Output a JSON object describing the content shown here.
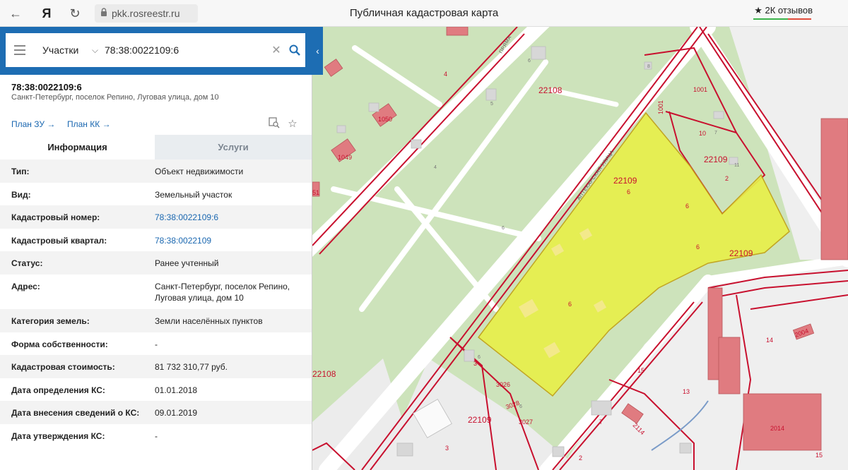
{
  "browser": {
    "url": "pkk.rosreestr.ru",
    "title": "Публичная кадастровая карта",
    "reviews": "2К отзывов",
    "brand_glyph": "Я"
  },
  "search": {
    "layer": "Участки",
    "value": "78:38:0022109:6"
  },
  "object": {
    "number": "78:38:0022109:6",
    "address": "Санкт-Петербург, поселок Репино, Луговая улица, дом 10",
    "plan_zu": "План ЗУ →",
    "plan_kk": "План КК →"
  },
  "tabs": {
    "info": "Информация",
    "services": "Услуги"
  },
  "info": [
    {
      "k": "Тип:",
      "v": "Объект недвижимости"
    },
    {
      "k": "Вид:",
      "v": "Земельный участок"
    },
    {
      "k": "Кадастровый номер:",
      "v": "78:38:0022109:6"
    },
    {
      "k": "Кадастровый квартал:",
      "v": "78:38:0022109"
    },
    {
      "k": "Статус:",
      "v": "Ранее учтенный"
    },
    {
      "k": "Адрес:",
      "v": "Санкт-Петербург, поселок Репино, Луговая улица, дом 10"
    },
    {
      "k": "Категория земель:",
      "v": "Земли населённых пунктов"
    },
    {
      "k": "Форма собственности:",
      "v": "-"
    },
    {
      "k": "Кадастровая стоимость:",
      "v": "81 732 310,77 руб."
    },
    {
      "k": "Дата определения КС:",
      "v": "01.01.2018"
    },
    {
      "k": "Дата внесения сведений о КС:",
      "v": "09.01.2019"
    },
    {
      "k": "Дата утверждения КС:",
      "v": "-"
    }
  ],
  "map_labels": {
    "street_apteka": "АПТЕКАРСКАЯ УЛИЦА",
    "street_pryam": "ПРЯМА",
    "q1": "22108",
    "q2": "22109",
    "q3": "22109",
    "q4": "22109",
    "q5": "22108",
    "q6": "22109",
    "p1001": "1001",
    "p1001v": "1001",
    "p10": "10",
    "p7": "7",
    "p11": "11",
    "p2": "2",
    "p6a": "6",
    "p6b": "6",
    "p6c": "6",
    "p6d": "6",
    "p6e": "6",
    "p6f": "6",
    "p1050": "1050",
    "p1049": "1049",
    "p51": "51",
    "p5": "5",
    "p3": "3",
    "p4": "4",
    "p4b": "4",
    "p8": "8",
    "p3026": "3026",
    "p3028": "3028",
    "p3027": "3027",
    "p3b": "3",
    "p14": "14",
    "p2004": "2004",
    "p15": "15",
    "p13": "13",
    "p7b": "7",
    "p2114": "2114",
    "p2014": "2014",
    "p15b": "15",
    "p2b": "2",
    "p6g": "6",
    "p6h": "6"
  }
}
